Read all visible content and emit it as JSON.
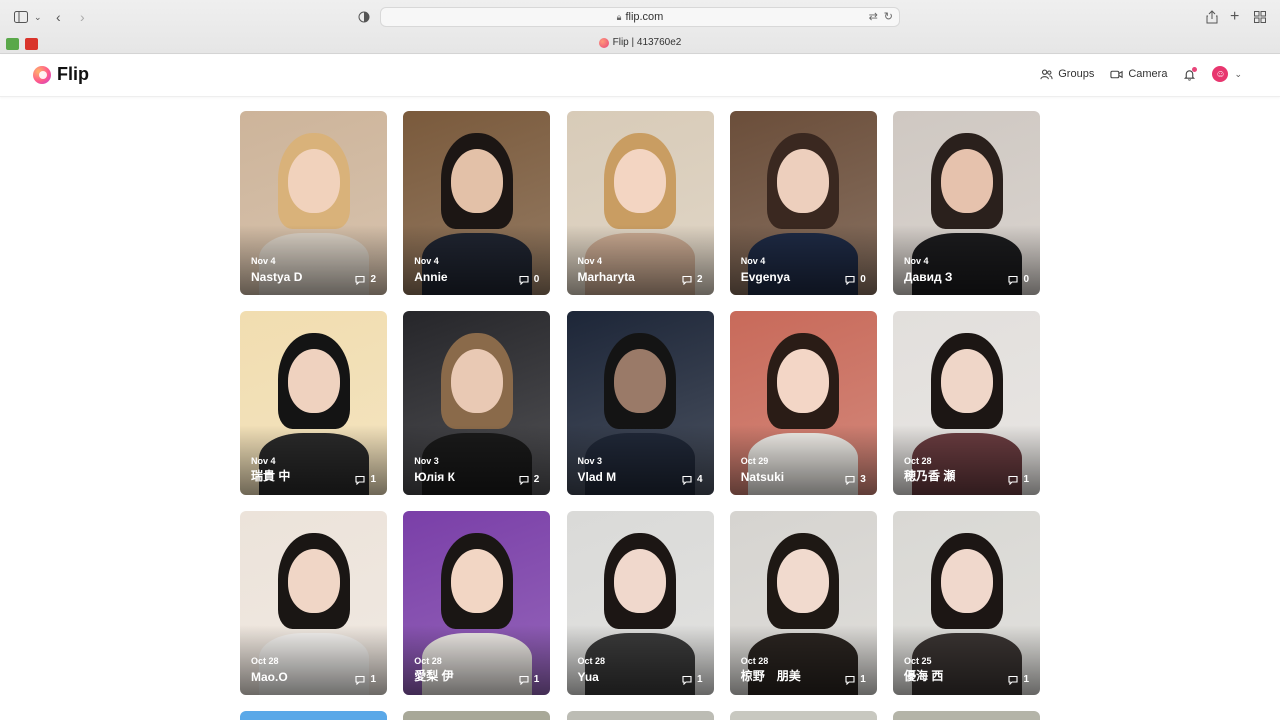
{
  "browser": {
    "url": "flip.com",
    "tab_title": "Flip | 413760e2",
    "bookmark_colors": [
      "#5aa84a",
      "#d9342b"
    ]
  },
  "header": {
    "logo_text": "Flip",
    "nav": {
      "groups": "Groups",
      "camera": "Camera"
    },
    "avatar_icon": "smiley-icon"
  },
  "colors": {
    "accent": "#e8366f"
  },
  "responses": [
    {
      "date": "Nov 4",
      "name": "Nastya D",
      "comments": "2",
      "bg": "#cdb49a",
      "skin": "#f1d2bc",
      "hair": "#d9b27a",
      "shirt": "#d9d0c4"
    },
    {
      "date": "Nov 4",
      "name": "Annie",
      "comments": "0",
      "bg": "#7a5a3c",
      "skin": "#e3c1a8",
      "hair": "#1c1614",
      "shirt": "#1f2430"
    },
    {
      "date": "Nov 4",
      "name": "Marharyta",
      "comments": "2",
      "bg": "#d8cbb8",
      "skin": "#f3d5c2",
      "hair": "#c99d62",
      "shirt": "#c8a890"
    },
    {
      "date": "Nov 4",
      "name": "Evgenya",
      "comments": "0",
      "bg": "#6b4e3a",
      "skin": "#edcfbd",
      "hair": "#3a2820",
      "shirt": "#1e2a44"
    },
    {
      "date": "Nov 4",
      "name": "Давид З",
      "comments": "0",
      "bg": "#cfc8c2",
      "skin": "#e6c2ad",
      "hair": "#2a201c",
      "shirt": "#1b1b1d"
    },
    {
      "date": "Nov 4",
      "name": "瑞貴 中",
      "comments": "1",
      "bg": "#f1ddb0",
      "skin": "#efd2bf",
      "hair": "#141414",
      "shirt": "#2a2a2a"
    },
    {
      "date": "Nov 3",
      "name": "Юлія К",
      "comments": "2",
      "bg": "#26262a",
      "skin": "#e9c9b4",
      "hair": "#8a6a4a",
      "shirt": "#1a1a1a"
    },
    {
      "date": "Nov 3",
      "name": "Vlad M",
      "comments": "4",
      "bg": "#1d2638",
      "skin": "#9a7a68",
      "hair": "#141414",
      "shirt": "#202838"
    },
    {
      "date": "Oct 29",
      "name": "Natsuki",
      "comments": "3",
      "bg": "#c86a5a",
      "skin": "#f3d6c6",
      "hair": "#2a1c16",
      "shirt": "#f0ede8"
    },
    {
      "date": "Oct 28",
      "name": "穂乃香 瀬",
      "comments": "1",
      "bg": "#e2dfdc",
      "skin": "#efd6c8",
      "hair": "#1c1614",
      "shirt": "#6a3c40"
    },
    {
      "date": "Oct 28",
      "name": "Mao.O",
      "comments": "1",
      "bg": "#ece3da",
      "skin": "#f0d6c6",
      "hair": "#1a1614",
      "shirt": "#f4f2ef"
    },
    {
      "date": "Oct 28",
      "name": "愛梨 伊",
      "comments": "1",
      "bg": "#7a3fa8",
      "skin": "#f2d6c4",
      "hair": "#1a1614",
      "shirt": "#ece8e4"
    },
    {
      "date": "Oct 28",
      "name": "Yua",
      "comments": "1",
      "bg": "#dadad8",
      "skin": "#f0d8cc",
      "hair": "#1c1614",
      "shirt": "#3a3a3a"
    },
    {
      "date": "Oct 28",
      "name": "椋野　朋美",
      "comments": "1",
      "bg": "#d6d4d0",
      "skin": "#f1dace",
      "hair": "#1e1814",
      "shirt": "#2a2420"
    },
    {
      "date": "Oct 25",
      "name": "優海 西",
      "comments": "1",
      "bg": "#d9d8d4",
      "skin": "#f0d8cc",
      "hair": "#1c1614",
      "shirt": "#3a3432"
    }
  ],
  "partial_row_colors": [
    "#5aa8e8",
    "#a8a898",
    "#bcbcb4",
    "#c8c8c0",
    "#b4b4a8"
  ]
}
